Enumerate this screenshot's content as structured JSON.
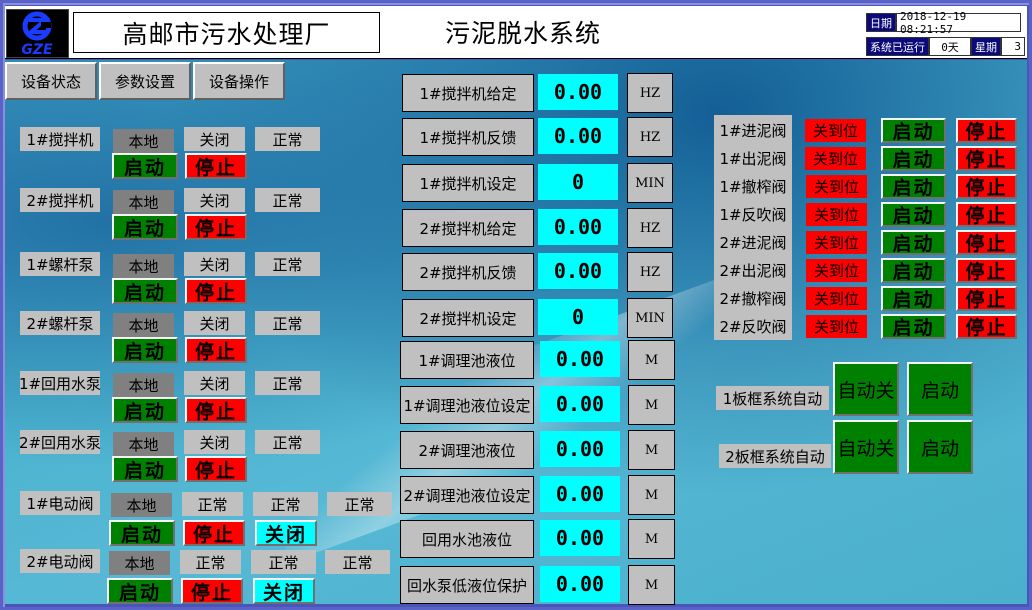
{
  "header": {
    "logo_text": "GZE",
    "plant_name": "高邮市污水处理厂",
    "system_name": "污泥脱水系统",
    "date_label": "日期",
    "date_value": "2018-12-19 08:21:57",
    "runtime_label": "系统已运行",
    "runtime_value": "0天",
    "weekday_label": "星期",
    "weekday_value": "3"
  },
  "tabs": [
    {
      "label": "设备状态"
    },
    {
      "label": "参数设置"
    },
    {
      "label": "设备操作"
    }
  ],
  "devices": [
    {
      "name": "1#搅拌机",
      "mode": "本地",
      "status1": "关闭",
      "status2": "正常",
      "start": "启动",
      "stop": "停止"
    },
    {
      "name": "2#搅拌机",
      "mode": "本地",
      "status1": "关闭",
      "status2": "正常",
      "start": "启动",
      "stop": "停止"
    },
    {
      "name": "1#螺杆泵",
      "mode": "本地",
      "status1": "关闭",
      "status2": "正常",
      "start": "启动",
      "stop": "停止"
    },
    {
      "name": "2#螺杆泵",
      "mode": "本地",
      "status1": "关闭",
      "status2": "正常",
      "start": "启动",
      "stop": "停止"
    },
    {
      "name": "1#回用水泵",
      "mode": "本地",
      "status1": "关闭",
      "status2": "正常",
      "start": "启动",
      "stop": "停止"
    },
    {
      "name": "2#回用水泵",
      "mode": "本地",
      "status1": "关闭",
      "status2": "正常",
      "start": "启动",
      "stop": "停止"
    }
  ],
  "electric_valves": [
    {
      "name": "1#电动阀",
      "mode": "本地",
      "status1": "正常",
      "status2": "正常",
      "status3": "正常",
      "start": "启动",
      "stop": "停止",
      "close": "关闭"
    },
    {
      "name": "2#电动阀",
      "mode": "本地",
      "status1": "正常",
      "status2": "正常",
      "status3": "正常",
      "start": "启动",
      "stop": "停止",
      "close": "关闭"
    }
  ],
  "parameters": [
    {
      "name": "1#搅拌机给定",
      "value": "0.00",
      "unit": "HZ"
    },
    {
      "name": "1#搅拌机反馈",
      "value": "0.00",
      "unit": "HZ"
    },
    {
      "name": "1#搅拌机设定",
      "value": "0",
      "unit": "MIN"
    },
    {
      "name": "2#搅拌机给定",
      "value": "0.00",
      "unit": "HZ"
    },
    {
      "name": "2#搅拌机反馈",
      "value": "0.00",
      "unit": "HZ"
    },
    {
      "name": "2#搅拌机设定",
      "value": "0",
      "unit": "MIN"
    },
    {
      "name": "1#调理池液位",
      "value": "0.00",
      "unit": "M"
    },
    {
      "name": "1#调理池液位设定",
      "value": "0.00",
      "unit": "M"
    },
    {
      "name": "2#调理池液位",
      "value": "0.00",
      "unit": "M"
    },
    {
      "name": "2#调理池液位设定",
      "value": "0.00",
      "unit": "M"
    },
    {
      "name": "回用水池液位",
      "value": "0.00",
      "unit": "M"
    },
    {
      "name": "回水泵低液位保护",
      "value": "0.00",
      "unit": "M"
    }
  ],
  "valves": [
    {
      "name": "1#进泥阀",
      "status": "关到位",
      "start": "启动",
      "stop": "停止"
    },
    {
      "name": "1#出泥阀",
      "status": "关到位",
      "start": "启动",
      "stop": "停止"
    },
    {
      "name": "1#撤榨阀",
      "status": "关到位",
      "start": "启动",
      "stop": "停止"
    },
    {
      "name": "1#反吹阀",
      "status": "关到位",
      "start": "启动",
      "stop": "停止"
    },
    {
      "name": "2#进泥阀",
      "status": "关到位",
      "start": "启动",
      "stop": "停止"
    },
    {
      "name": "2#出泥阀",
      "status": "关到位",
      "start": "启动",
      "stop": "停止"
    },
    {
      "name": "2#撤榨阀",
      "status": "关到位",
      "start": "启动",
      "stop": "停止"
    },
    {
      "name": "2#反吹阀",
      "status": "关到位",
      "start": "启动",
      "stop": "停止"
    }
  ],
  "filter_press": [
    {
      "name": "1板框系统自动",
      "auto_label": "自动关",
      "start": "启动"
    },
    {
      "name": "2板框系统自动",
      "auto_label": "自动关",
      "start": "启动"
    }
  ],
  "colors": {
    "run_green": "#008000",
    "stop_red": "#ff0000",
    "value_cyan": "#00ffff",
    "panel_gray": "#c0c0c0",
    "local_gray": "#808080",
    "header_navy": "#0a0a7a"
  }
}
